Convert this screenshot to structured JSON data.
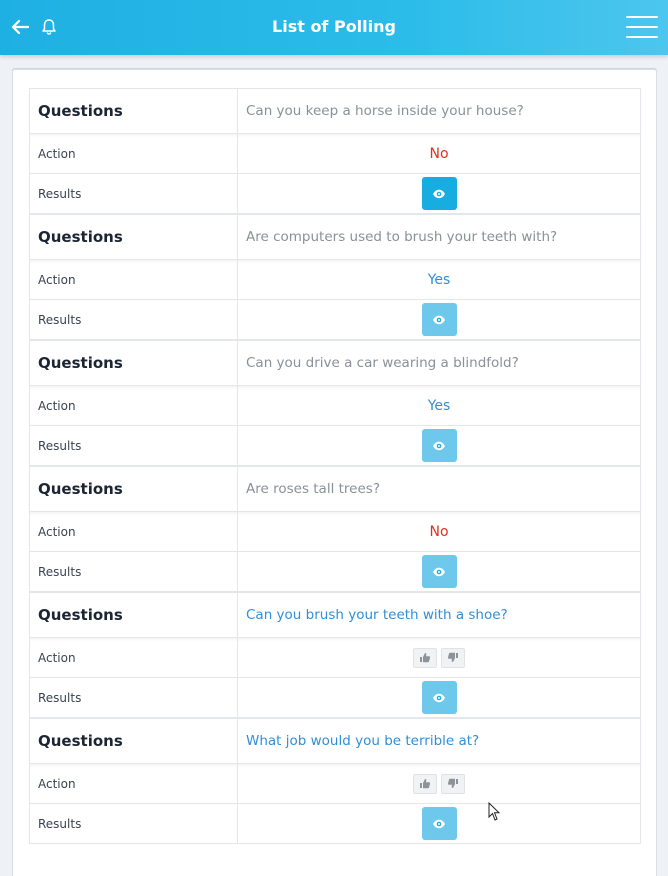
{
  "header": {
    "title": "List of Polling"
  },
  "labels": {
    "questions": "Questions",
    "action": "Action",
    "results": "Results"
  },
  "polls": [
    {
      "question": "Can you keep a horse inside your house?",
      "question_state": "answered",
      "action": "No",
      "action_type": "no",
      "results_state": "active"
    },
    {
      "question": "Are computers used to brush your teeth with?",
      "question_state": "answered",
      "action": "Yes",
      "action_type": "yes",
      "results_state": "dim"
    },
    {
      "question": "Can you drive a car wearing a blindfold?",
      "question_state": "answered",
      "action": "Yes",
      "action_type": "yes",
      "results_state": "dim"
    },
    {
      "question": "Are roses tall trees?",
      "question_state": "answered",
      "action": "No",
      "action_type": "no",
      "results_state": "dim"
    },
    {
      "question": "Can you brush your teeth with a shoe?",
      "question_state": "open",
      "action": "",
      "action_type": "vote",
      "results_state": "dim"
    },
    {
      "question": "What job would you be terrible at?",
      "question_state": "open",
      "action": "",
      "action_type": "vote",
      "results_state": "dim"
    }
  ],
  "icons": {
    "back": "arrow-left-icon",
    "notify": "bell-icon",
    "menu": "hamburger-menu-icon",
    "results": "eye-icon",
    "like": "thumbs-up-icon",
    "dislike": "thumbs-down-icon"
  },
  "colors": {
    "header_bg": "#1fb0e3",
    "no": "#e0301e",
    "yes": "#2f8fd8",
    "eye_active": "#18ade0",
    "eye_dim": "#6dc8eb"
  }
}
